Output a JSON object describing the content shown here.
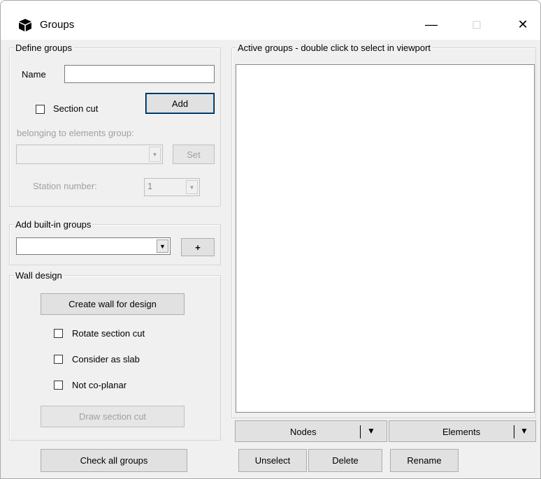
{
  "window": {
    "title": "Groups",
    "app_icon": "cube-icon",
    "minimize_glyph": "—",
    "maximize_glyph": "□",
    "close_glyph": "✕"
  },
  "define_groups": {
    "legend": "Define groups",
    "name_label": "Name",
    "name_value": "",
    "section_cut_label": "Section cut",
    "section_cut_checked": false,
    "add_label": "Add",
    "belonging_label": "belonging to elements group:",
    "elements_group_value": "",
    "set_label": "Set",
    "station_label": "Station number:",
    "station_value": "1"
  },
  "builtin_groups": {
    "legend": "Add built-in groups",
    "selected_value": "",
    "add_label": "+"
  },
  "wall_design": {
    "legend": "Wall design",
    "create_wall_label": "Create wall for design",
    "rotate_label": "Rotate section cut",
    "rotate_checked": false,
    "slab_label": "Consider as slab",
    "slab_checked": false,
    "coplanar_label": "Not co-planar",
    "coplanar_checked": false,
    "draw_section_label": "Draw section cut"
  },
  "check_all_label": "Check all groups",
  "active_groups": {
    "legend": "Active groups - double click to select in viewport",
    "items": []
  },
  "bottom_bar": {
    "nodes_label": "Nodes",
    "elements_label": "Elements",
    "dropdown_glyph": "▼",
    "unselect_label": "Unselect",
    "delete_label": "Delete",
    "rename_label": "Rename"
  }
}
